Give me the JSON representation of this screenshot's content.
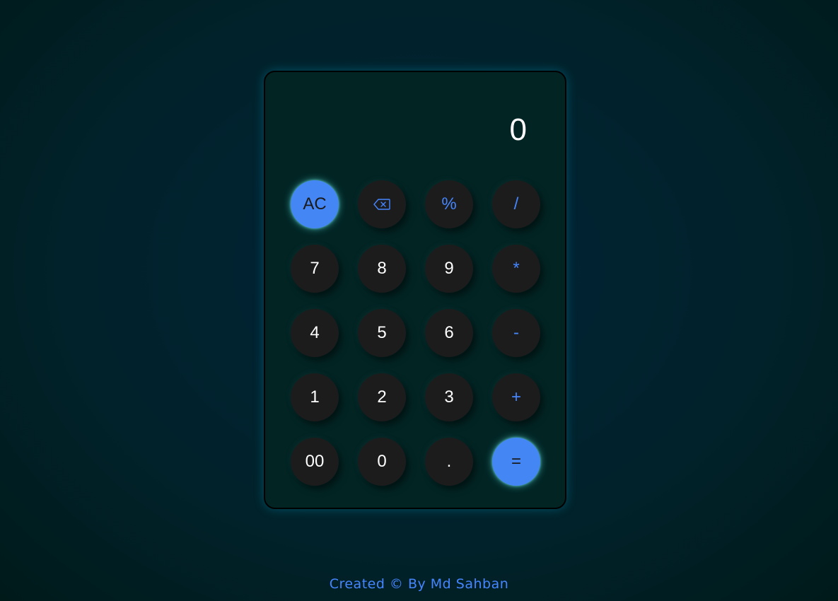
{
  "display": {
    "value": "0"
  },
  "keys": {
    "ac": "AC",
    "backspace_icon": "backspace-icon",
    "percent": "%",
    "divide": "/",
    "seven": "7",
    "eight": "8",
    "nine": "9",
    "multiply": "*",
    "four": "4",
    "five": "5",
    "six": "6",
    "subtract": "-",
    "one": "1",
    "two": "2",
    "three": "3",
    "add": "+",
    "double_zero": "00",
    "zero": "0",
    "decimal": ".",
    "equals": "="
  },
  "colors": {
    "accent": "#4586f5",
    "operator_text": "#4586ff",
    "key_bg": "#1c1c1c",
    "panel_bg": "#022524",
    "glow": "#5adcdc"
  },
  "footer": {
    "credit": "Created © By Md Sahban"
  }
}
